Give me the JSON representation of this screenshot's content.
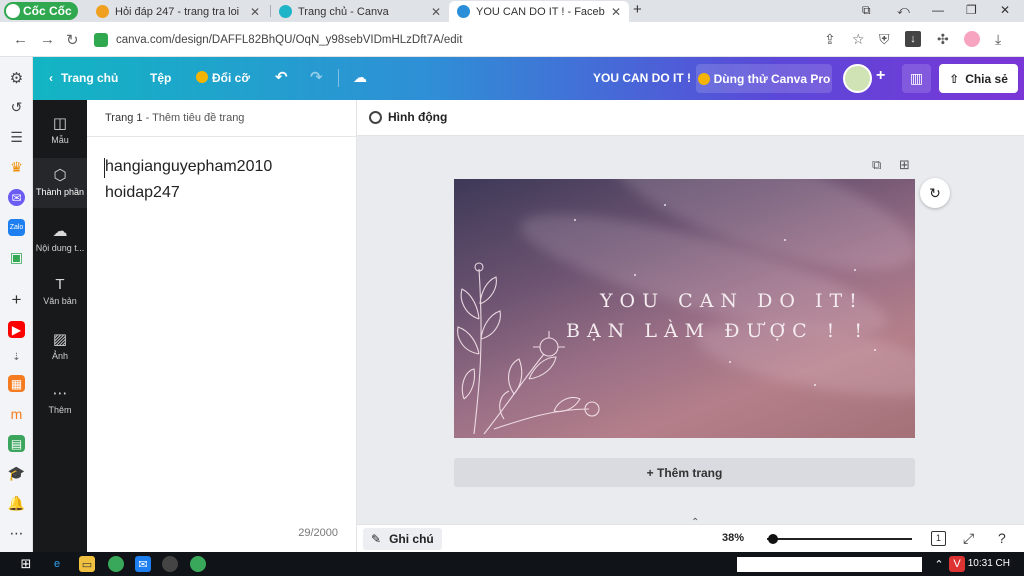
{
  "browser": {
    "brand": "Cốc Cốc",
    "tabs": [
      {
        "title": "Hỏi đáp 247 - trang tra loi",
        "favicon_color": "#f0a020"
      },
      {
        "title": "Trang chủ - Canva",
        "favicon_color": "#20b4c8"
      },
      {
        "title": "YOU CAN DO IT ! - Facebook",
        "favicon_color": "#2a8fd8"
      }
    ],
    "new_tab": "+",
    "url": "canva.com/design/DAFFL82BhQU/OqN_y98sebVIDmHLzDft7A/edit"
  },
  "canva_header": {
    "home": "Trang chủ",
    "file": "Tệp",
    "resize": "Đổi cỡ",
    "design_title": "YOU CAN DO IT !",
    "try_pro": "Dùng thử Canva Pro",
    "share": "Chia sẻ"
  },
  "side_panel": [
    {
      "label": "Mẫu",
      "icon": "template-icon"
    },
    {
      "label": "Thành phần",
      "icon": "elements-icon"
    },
    {
      "label": "Nội dung t...",
      "icon": "upload-icon"
    },
    {
      "label": "Văn bản",
      "icon": "text-icon"
    },
    {
      "label": "Ảnh",
      "icon": "photo-icon"
    },
    {
      "label": "Thêm",
      "icon": "more-icon"
    }
  ],
  "notes": {
    "page_label": "Trang 1",
    "separator": " - ",
    "page_title_placeholder": "Thêm tiêu đề trang",
    "lines": [
      "hangianguyepham2010",
      "hoidap247"
    ],
    "char_count": "29/2000"
  },
  "editor": {
    "animate": "Hình động",
    "design_line1": "YOU CAN DO IT!",
    "design_line2": "BẠN LÀM ĐƯỢC ! !",
    "add_page": "+ Thêm trang",
    "notes_button": "Ghi chú",
    "zoom": "38%",
    "zoom_fraction": 0.04,
    "page_count": "1"
  },
  "taskbar": {
    "time": "10:31 CH"
  }
}
